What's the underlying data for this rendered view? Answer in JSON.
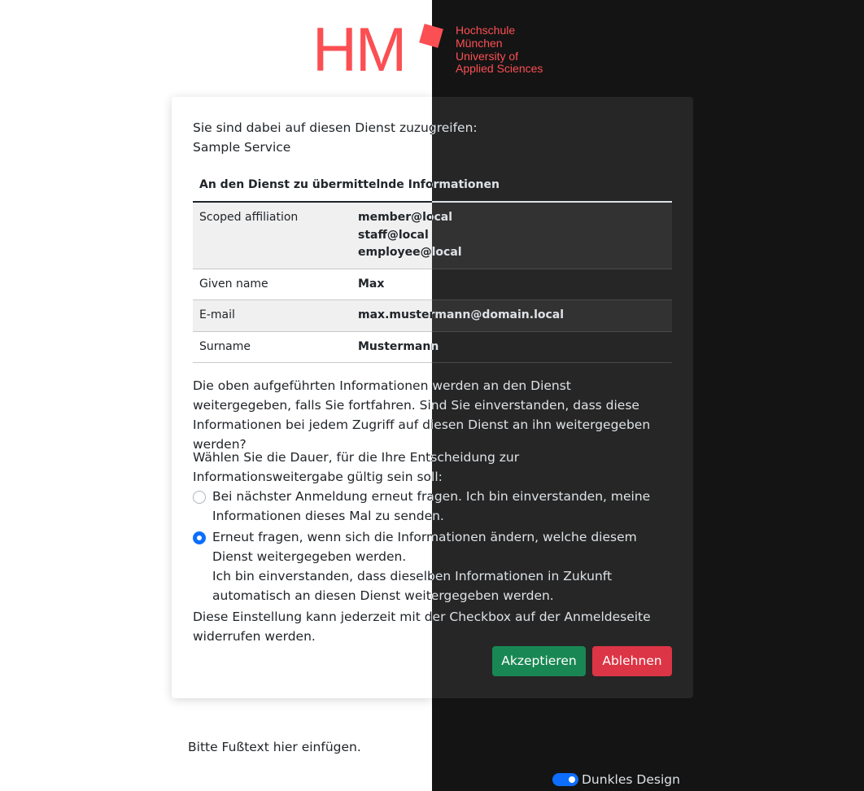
{
  "logo": {
    "mark": "HM",
    "lines": [
      "Hochschule",
      "München",
      "University of",
      "Applied Sciences"
    ]
  },
  "intro": {
    "line1": "Sie sind dabei auf diesen Dienst zuzugreifen:",
    "service_name": "Sample Service"
  },
  "attributes": {
    "header": "An den Dienst zu übermittelnde Informationen",
    "rows": [
      {
        "name": "Scoped affiliation",
        "values": [
          "member@local",
          "staff@local",
          "employee@local"
        ]
      },
      {
        "name": "Given name",
        "values": [
          "Max"
        ]
      },
      {
        "name": "E-mail",
        "values": [
          "max.mustermann@domain.local"
        ]
      },
      {
        "name": "Surname",
        "values": [
          "Mustermann"
        ]
      }
    ]
  },
  "question": "Die oben aufgeführten Informationen werden an den Dienst weitergegeben, falls Sie fortfahren. Sind Sie einverstanden, dass diese Informationen bei jedem Zugriff auf diesen Dienst an ihn weitergegeben werden?",
  "duration": {
    "prompt": "Wählen Sie die Dauer, für die Ihre Entscheidung zur Informationsweitergabe gültig sein soll:",
    "options": [
      {
        "text": "Bei nächster Anmeldung erneut fragen. Ich bin einverstanden, meine Informationen dieses Mal zu senden.",
        "checked": false
      },
      {
        "text": "Erneut fragen, wenn sich die Informationen ändern, welche diesem Dienst weitergegeben werden.",
        "text2": "Ich bin einverstanden, dass dieselben Informationen in Zukunft automatisch an diesen Dienst weitergegeben werden.",
        "checked": true
      }
    ],
    "note": "Diese Einstellung kann jederzeit mit der Checkbox auf der Anmeldeseite widerrufen werden."
  },
  "buttons": {
    "accept": "Akzeptieren",
    "reject": "Ablehnen"
  },
  "footer": "Bitte Fußtext hier einfügen.",
  "theme_toggle": {
    "label": "Dunkles Design",
    "on": true
  },
  "colors": {
    "brand": "#fb4f53",
    "accept": "#198754",
    "reject": "#dc3545",
    "switch": "#0d6efd",
    "dark_bg": "#141414",
    "dark_card": "#262626"
  }
}
